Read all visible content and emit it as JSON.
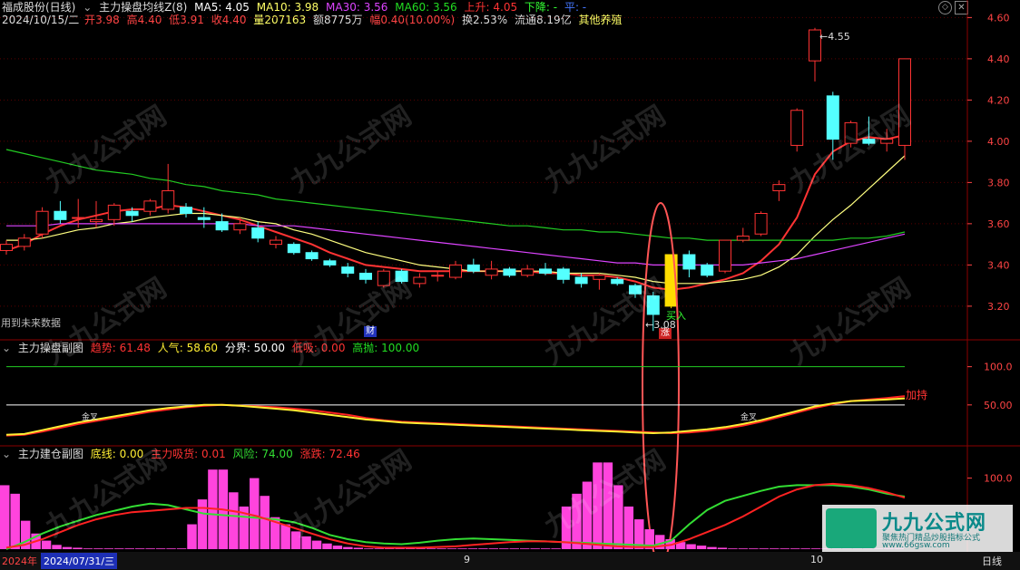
{
  "header": {
    "stock_title": "福成股份(日线)",
    "indicator_name": "主力操盘均线Z(8)",
    "ma5": "MA5: 4.05",
    "ma10": "MA10: 3.98",
    "ma30": "MA30: 3.56",
    "ma60": "MA60: 3.56",
    "up_label": "上升: 4.05",
    "down_label": "下降: -",
    "flat_label": "平: -",
    "date": "2024/10/15/二",
    "open_lbl": "开",
    "open": "3.98",
    "high_lbl": "高",
    "high": "4.40",
    "low_lbl": "低",
    "low": "3.91",
    "close_lbl": "收",
    "close": "4.40",
    "vol_lbl": "量",
    "vol": "207163",
    "amount": "额8775万",
    "change_lbl": "幅",
    "change": "0.40(10.00%)",
    "turnover": "换2.53%",
    "float": "流通8.19亿",
    "sector": "其他养殖"
  },
  "main_notes": {
    "future_data": "用到未来数据",
    "finance_mark": "财",
    "zhang_mark": "涨",
    "buy_label": "买入",
    "high_marker": "4.55",
    "low_marker": "3.08"
  },
  "sub1": {
    "title": "主力操盘副图",
    "trend": "趋势: 61.48",
    "popularity": "人气: 58.60",
    "divider": "分界: 50.00",
    "low_buy": "低吸: 0.00",
    "high_sell": "高抛: 100.00",
    "add_label": "加持",
    "cross_label": "金叉"
  },
  "sub2": {
    "title": "主力建仓副图",
    "bottom_line": "底线: 0.00",
    "main_absorb": "主力吸货: 0.01",
    "risk": "风险: 74.00",
    "rise_fall": "涨跌: 72.46"
  },
  "footer": {
    "year": "2024年",
    "date_box": "2024/07/31/三",
    "month_9": "9",
    "month_10": "10",
    "period": "日线"
  },
  "brand": {
    "name": "九九公式网",
    "slogan": "聚焦热门精品炒股指标公式",
    "url": "www.66gsw.com"
  },
  "chart_data": [
    {
      "type": "candlestick",
      "title": "福成股份(日线)",
      "ylim": [
        3.05,
        4.65
      ],
      "yticks": [
        3.2,
        3.4,
        3.6,
        3.8,
        4.0,
        4.2,
        4.4,
        4.6
      ],
      "candles": [
        {
          "o": 3.47,
          "h": 3.52,
          "l": 3.45,
          "c": 3.5
        },
        {
          "o": 3.49,
          "h": 3.55,
          "l": 3.47,
          "c": 3.53
        },
        {
          "o": 3.55,
          "h": 3.68,
          "l": 3.53,
          "c": 3.66
        },
        {
          "o": 3.66,
          "h": 3.71,
          "l": 3.6,
          "c": 3.62
        },
        {
          "o": 3.63,
          "h": 3.72,
          "l": 3.58,
          "c": 3.63
        },
        {
          "o": 3.61,
          "h": 3.71,
          "l": 3.58,
          "c": 3.62
        },
        {
          "o": 3.62,
          "h": 3.7,
          "l": 3.59,
          "c": 3.69
        },
        {
          "o": 3.66,
          "h": 3.68,
          "l": 3.61,
          "c": 3.64
        },
        {
          "o": 3.66,
          "h": 3.72,
          "l": 3.64,
          "c": 3.71
        },
        {
          "o": 3.67,
          "h": 3.89,
          "l": 3.65,
          "c": 3.76
        },
        {
          "o": 3.68,
          "h": 3.7,
          "l": 3.63,
          "c": 3.65
        },
        {
          "o": 3.63,
          "h": 3.68,
          "l": 3.58,
          "c": 3.62
        },
        {
          "o": 3.61,
          "h": 3.65,
          "l": 3.56,
          "c": 3.57
        },
        {
          "o": 3.57,
          "h": 3.63,
          "l": 3.55,
          "c": 3.6
        },
        {
          "o": 3.58,
          "h": 3.61,
          "l": 3.51,
          "c": 3.53
        },
        {
          "o": 3.5,
          "h": 3.54,
          "l": 3.48,
          "c": 3.52
        },
        {
          "o": 3.5,
          "h": 3.51,
          "l": 3.45,
          "c": 3.46
        },
        {
          "o": 3.46,
          "h": 3.47,
          "l": 3.42,
          "c": 3.43
        },
        {
          "o": 3.42,
          "h": 3.43,
          "l": 3.39,
          "c": 3.4
        },
        {
          "o": 3.39,
          "h": 3.41,
          "l": 3.34,
          "c": 3.36
        },
        {
          "o": 3.36,
          "h": 3.38,
          "l": 3.31,
          "c": 3.33
        },
        {
          "o": 3.3,
          "h": 3.38,
          "l": 3.29,
          "c": 3.37
        },
        {
          "o": 3.37,
          "h": 3.38,
          "l": 3.31,
          "c": 3.32
        },
        {
          "o": 3.31,
          "h": 3.36,
          "l": 3.29,
          "c": 3.34
        },
        {
          "o": 3.35,
          "h": 3.37,
          "l": 3.32,
          "c": 3.35
        },
        {
          "o": 3.34,
          "h": 3.42,
          "l": 3.33,
          "c": 3.4
        },
        {
          "o": 3.4,
          "h": 3.43,
          "l": 3.36,
          "c": 3.37
        },
        {
          "o": 3.35,
          "h": 3.42,
          "l": 3.33,
          "c": 3.38
        },
        {
          "o": 3.38,
          "h": 3.39,
          "l": 3.34,
          "c": 3.35
        },
        {
          "o": 3.35,
          "h": 3.4,
          "l": 3.34,
          "c": 3.38
        },
        {
          "o": 3.38,
          "h": 3.41,
          "l": 3.35,
          "c": 3.36
        },
        {
          "o": 3.38,
          "h": 3.39,
          "l": 3.31,
          "c": 3.33
        },
        {
          "o": 3.34,
          "h": 3.36,
          "l": 3.29,
          "c": 3.31
        },
        {
          "o": 3.33,
          "h": 3.36,
          "l": 3.28,
          "c": 3.35
        },
        {
          "o": 3.33,
          "h": 3.34,
          "l": 3.3,
          "c": 3.31
        },
        {
          "o": 3.3,
          "h": 3.31,
          "l": 3.24,
          "c": 3.26
        },
        {
          "o": 3.25,
          "h": 3.27,
          "l": 3.08,
          "c": 3.16
        },
        {
          "o": 3.2,
          "h": 3.45,
          "l": 3.19,
          "c": 3.45
        },
        {
          "o": 3.45,
          "h": 3.47,
          "l": 3.34,
          "c": 3.38
        },
        {
          "o": 3.4,
          "h": 3.41,
          "l": 3.34,
          "c": 3.35
        },
        {
          "o": 3.37,
          "h": 3.52,
          "l": 3.36,
          "c": 3.52
        },
        {
          "o": 3.52,
          "h": 3.58,
          "l": 3.51,
          "c": 3.54
        },
        {
          "o": 3.55,
          "h": 3.66,
          "l": 3.54,
          "c": 3.65
        },
        {
          "o": 3.76,
          "h": 3.81,
          "l": 3.71,
          "c": 3.79
        },
        {
          "o": 3.98,
          "h": 4.16,
          "l": 3.95,
          "c": 4.15
        },
        {
          "o": 4.39,
          "h": 4.55,
          "l": 4.29,
          "c": 4.54
        },
        {
          "o": 4.22,
          "h": 4.24,
          "l": 3.91,
          "c": 4.01
        },
        {
          "o": 3.99,
          "h": 4.1,
          "l": 3.97,
          "c": 4.09
        },
        {
          "o": 4.01,
          "h": 4.12,
          "l": 3.98,
          "c": 3.99
        },
        {
          "o": 3.99,
          "h": 4.06,
          "l": 3.95,
          "c": 4.01
        },
        {
          "o": 3.98,
          "h": 4.4,
          "l": 3.91,
          "c": 4.4
        }
      ],
      "series": [
        {
          "name": "MA5",
          "color": "#ff3333",
          "values": [
            3.47,
            3.5,
            3.55,
            3.59,
            3.62,
            3.64,
            3.66,
            3.67,
            3.67,
            3.69,
            3.68,
            3.66,
            3.64,
            3.62,
            3.59,
            3.56,
            3.53,
            3.5,
            3.46,
            3.43,
            3.4,
            3.39,
            3.38,
            3.37,
            3.37,
            3.37,
            3.37,
            3.37,
            3.37,
            3.37,
            3.36,
            3.36,
            3.35,
            3.35,
            3.34,
            3.32,
            3.29,
            3.28,
            3.29,
            3.31,
            3.33,
            3.36,
            3.42,
            3.5,
            3.63,
            3.84,
            3.95,
            4.0,
            4.02,
            4.01,
            4.03
          ]
        },
        {
          "name": "MA10",
          "color": "#ffff80",
          "values": [
            3.52,
            3.52,
            3.53,
            3.55,
            3.57,
            3.58,
            3.6,
            3.61,
            3.63,
            3.64,
            3.65,
            3.65,
            3.64,
            3.63,
            3.61,
            3.6,
            3.57,
            3.55,
            3.52,
            3.49,
            3.46,
            3.44,
            3.42,
            3.4,
            3.39,
            3.38,
            3.37,
            3.37,
            3.37,
            3.37,
            3.37,
            3.36,
            3.36,
            3.36,
            3.35,
            3.34,
            3.32,
            3.31,
            3.31,
            3.31,
            3.32,
            3.33,
            3.35,
            3.39,
            3.45,
            3.54,
            3.62,
            3.69,
            3.77,
            3.85,
            3.93
          ]
        },
        {
          "name": "MA30",
          "color": "#dd44ff",
          "values": [
            3.59,
            3.59,
            3.59,
            3.6,
            3.6,
            3.6,
            3.6,
            3.6,
            3.6,
            3.6,
            3.6,
            3.6,
            3.6,
            3.6,
            3.59,
            3.59,
            3.59,
            3.58,
            3.57,
            3.56,
            3.55,
            3.54,
            3.53,
            3.52,
            3.51,
            3.5,
            3.49,
            3.48,
            3.47,
            3.46,
            3.45,
            3.44,
            3.43,
            3.42,
            3.41,
            3.41,
            3.4,
            3.4,
            3.4,
            3.4,
            3.4,
            3.4,
            3.41,
            3.42,
            3.43,
            3.45,
            3.47,
            3.49,
            3.51,
            3.53,
            3.55
          ]
        },
        {
          "name": "MA60",
          "color": "#22cc22",
          "values": [
            3.96,
            3.94,
            3.92,
            3.9,
            3.88,
            3.86,
            3.85,
            3.84,
            3.82,
            3.81,
            3.79,
            3.78,
            3.76,
            3.75,
            3.74,
            3.72,
            3.71,
            3.7,
            3.69,
            3.68,
            3.67,
            3.66,
            3.65,
            3.64,
            3.63,
            3.62,
            3.61,
            3.6,
            3.59,
            3.59,
            3.58,
            3.57,
            3.57,
            3.56,
            3.56,
            3.55,
            3.54,
            3.53,
            3.53,
            3.52,
            3.52,
            3.52,
            3.52,
            3.52,
            3.52,
            3.52,
            3.52,
            3.53,
            3.53,
            3.54,
            3.56
          ]
        }
      ]
    },
    {
      "type": "line",
      "title": "主力操盘副图",
      "ylim": [
        0,
        115
      ],
      "yticks": [
        50.0,
        100.0
      ],
      "series": [
        {
          "name": "趋势",
          "color": "#ff2222",
          "values": [
            10,
            11,
            15,
            20,
            25,
            29,
            33,
            37,
            41,
            44,
            47,
            49,
            50,
            49,
            48,
            47,
            45,
            43,
            40,
            37,
            33,
            30,
            28,
            27,
            26,
            25,
            24,
            23,
            22,
            21,
            20,
            19,
            18,
            17,
            16,
            15,
            14,
            13,
            14,
            16,
            19,
            23,
            28,
            34,
            40,
            46,
            51,
            55,
            57,
            59,
            61.48
          ]
        },
        {
          "name": "人气",
          "color": "#ffee33",
          "values": [
            11,
            12,
            17,
            22,
            27,
            31,
            35,
            39,
            43,
            46,
            48,
            50,
            50,
            49,
            47,
            45,
            43,
            40,
            37,
            34,
            31,
            29,
            27,
            26,
            25,
            24,
            23,
            22,
            21,
            20,
            19,
            18,
            17,
            16,
            15,
            14,
            13,
            14,
            16,
            18,
            21,
            25,
            30,
            36,
            42,
            48,
            52,
            55,
            56,
            57,
            58.6
          ]
        }
      ]
    },
    {
      "type": "bar",
      "title": "主力建仓副图",
      "ylim": [
        0,
        125
      ],
      "yticks": [
        100.0
      ],
      "values": [
        90,
        75,
        42,
        22,
        12,
        6,
        3,
        2,
        1,
        0,
        0,
        0,
        0,
        0,
        0,
        0,
        0,
        0,
        0,
        0,
        0,
        0,
        0,
        0,
        0,
        0,
        0,
        0,
        0,
        0,
        0,
        0,
        0,
        0,
        0,
        0,
        0,
        0,
        0,
        0,
        0,
        0,
        0,
        0,
        0,
        0,
        0,
        0,
        0,
        0,
        0,
        0,
        0,
        0,
        0,
        0,
        0,
        0,
        0,
        0,
        0,
        0,
        0,
        0,
        0,
        0,
        0,
        0,
        0,
        0,
        0,
        0,
        0,
        0,
        0,
        0,
        0,
        0,
        0,
        0,
        0,
        0,
        0,
        0,
        0,
        0,
        0,
        0,
        0,
        0,
        0,
        0,
        0,
        0,
        0,
        0,
        0,
        0,
        0,
        0,
        0,
        0,
        0,
        0,
        0,
        0,
        0,
        0,
        0,
        0,
        0,
        0,
        0,
        0,
        0,
        0,
        0,
        0,
        0,
        0,
        0,
        0,
        0,
        0,
        0,
        0,
        0,
        0,
        0,
        0,
        0,
        0,
        0,
        0,
        0,
        0,
        0,
        0,
        0,
        0,
        0,
        0,
        0,
        0,
        0,
        0,
        0,
        0,
        0,
        0,
        0,
        0,
        0,
        0,
        0,
        0,
        0,
        0,
        0,
        0,
        0,
        0,
        0,
        0,
        0,
        0,
        0,
        0,
        0,
        0,
        0,
        0,
        0,
        0,
        0,
        0,
        0,
        0,
        0,
        0,
        0,
        0,
        0,
        0,
        0,
        0,
        0,
        0,
        0,
        0,
        0,
        0,
        0,
        0,
        0,
        0,
        0,
        0,
        0,
        0,
        0,
        0,
        0,
        0,
        0,
        0,
        0,
        0,
        0,
        0,
        0,
        0,
        0,
        0,
        0,
        0,
        0,
        0,
        0,
        0,
        0,
        0,
        0,
        0,
        0,
        0,
        0,
        0,
        0,
        0,
        0,
        0,
        0,
        0,
        0,
        0,
        0,
        0,
        0,
        0,
        0,
        0,
        0,
        0,
        0,
        0,
        0,
        0,
        0,
        0,
        0,
        0,
        0,
        0,
        0,
        0,
        0,
        0,
        0,
        0,
        0,
        0,
        0,
        0,
        0,
        0,
        0,
        0,
        0,
        0,
        0,
        0,
        0,
        0,
        0,
        0,
        0,
        0,
        0,
        0,
        0,
        0,
        0,
        0,
        0,
        0,
        0,
        0,
        0,
        0,
        0,
        0,
        0,
        0,
        0,
        0,
        0,
        0,
        0,
        0,
        0,
        0,
        0,
        0,
        0,
        0,
        0,
        0,
        0,
        0,
        0,
        0,
        0,
        0,
        0,
        0,
        0,
        0,
        0,
        0,
        0,
        0,
        0,
        0,
        0
      ],
      "bar_values": [
        90,
        78,
        40,
        22,
        12,
        6,
        3,
        2,
        1,
        1,
        1,
        1,
        1,
        1,
        1,
        1,
        1,
        1,
        35,
        70,
        112,
        112,
        80,
        60,
        100,
        75,
        45,
        35,
        25,
        18,
        12,
        8,
        5,
        3,
        2,
        1,
        1,
        1,
        1,
        1,
        1,
        1,
        1,
        1,
        1,
        1,
        1,
        1,
        1,
        1,
        1,
        1,
        1,
        1,
        60,
        78,
        95,
        122,
        122,
        90,
        60,
        42,
        28,
        20,
        14,
        10,
        7,
        5,
        3,
        2,
        1,
        1,
        1,
        1,
        1,
        1,
        1,
        1,
        1,
        1,
        1,
        1,
        1,
        1,
        1,
        1,
        1
      ],
      "series": [
        {
          "name": "风险",
          "color": "#33dd33",
          "values": [
            0,
            10,
            22,
            32,
            40,
            48,
            54,
            60,
            64,
            62,
            56,
            50,
            48,
            46,
            44,
            42,
            38,
            30,
            20,
            14,
            10,
            8,
            7,
            9,
            12,
            14,
            15,
            14,
            13,
            12,
            11,
            10,
            9,
            8,
            7,
            6,
            5,
            12,
            35,
            55,
            68,
            75,
            82,
            88,
            90,
            90,
            90,
            88,
            84,
            78,
            74
          ]
        },
        {
          "name": "涨跌",
          "color": "#ff2222",
          "values": [
            2,
            6,
            14,
            24,
            34,
            42,
            48,
            52,
            54,
            56,
            58,
            58,
            56,
            52,
            46,
            38,
            30,
            22,
            14,
            8,
            4,
            2,
            2,
            2,
            3,
            4,
            6,
            8,
            10,
            11,
            11,
            10,
            8,
            6,
            4,
            3,
            3,
            6,
            14,
            24,
            34,
            46,
            60,
            74,
            84,
            90,
            92,
            90,
            86,
            80,
            72.46
          ]
        }
      ]
    }
  ]
}
